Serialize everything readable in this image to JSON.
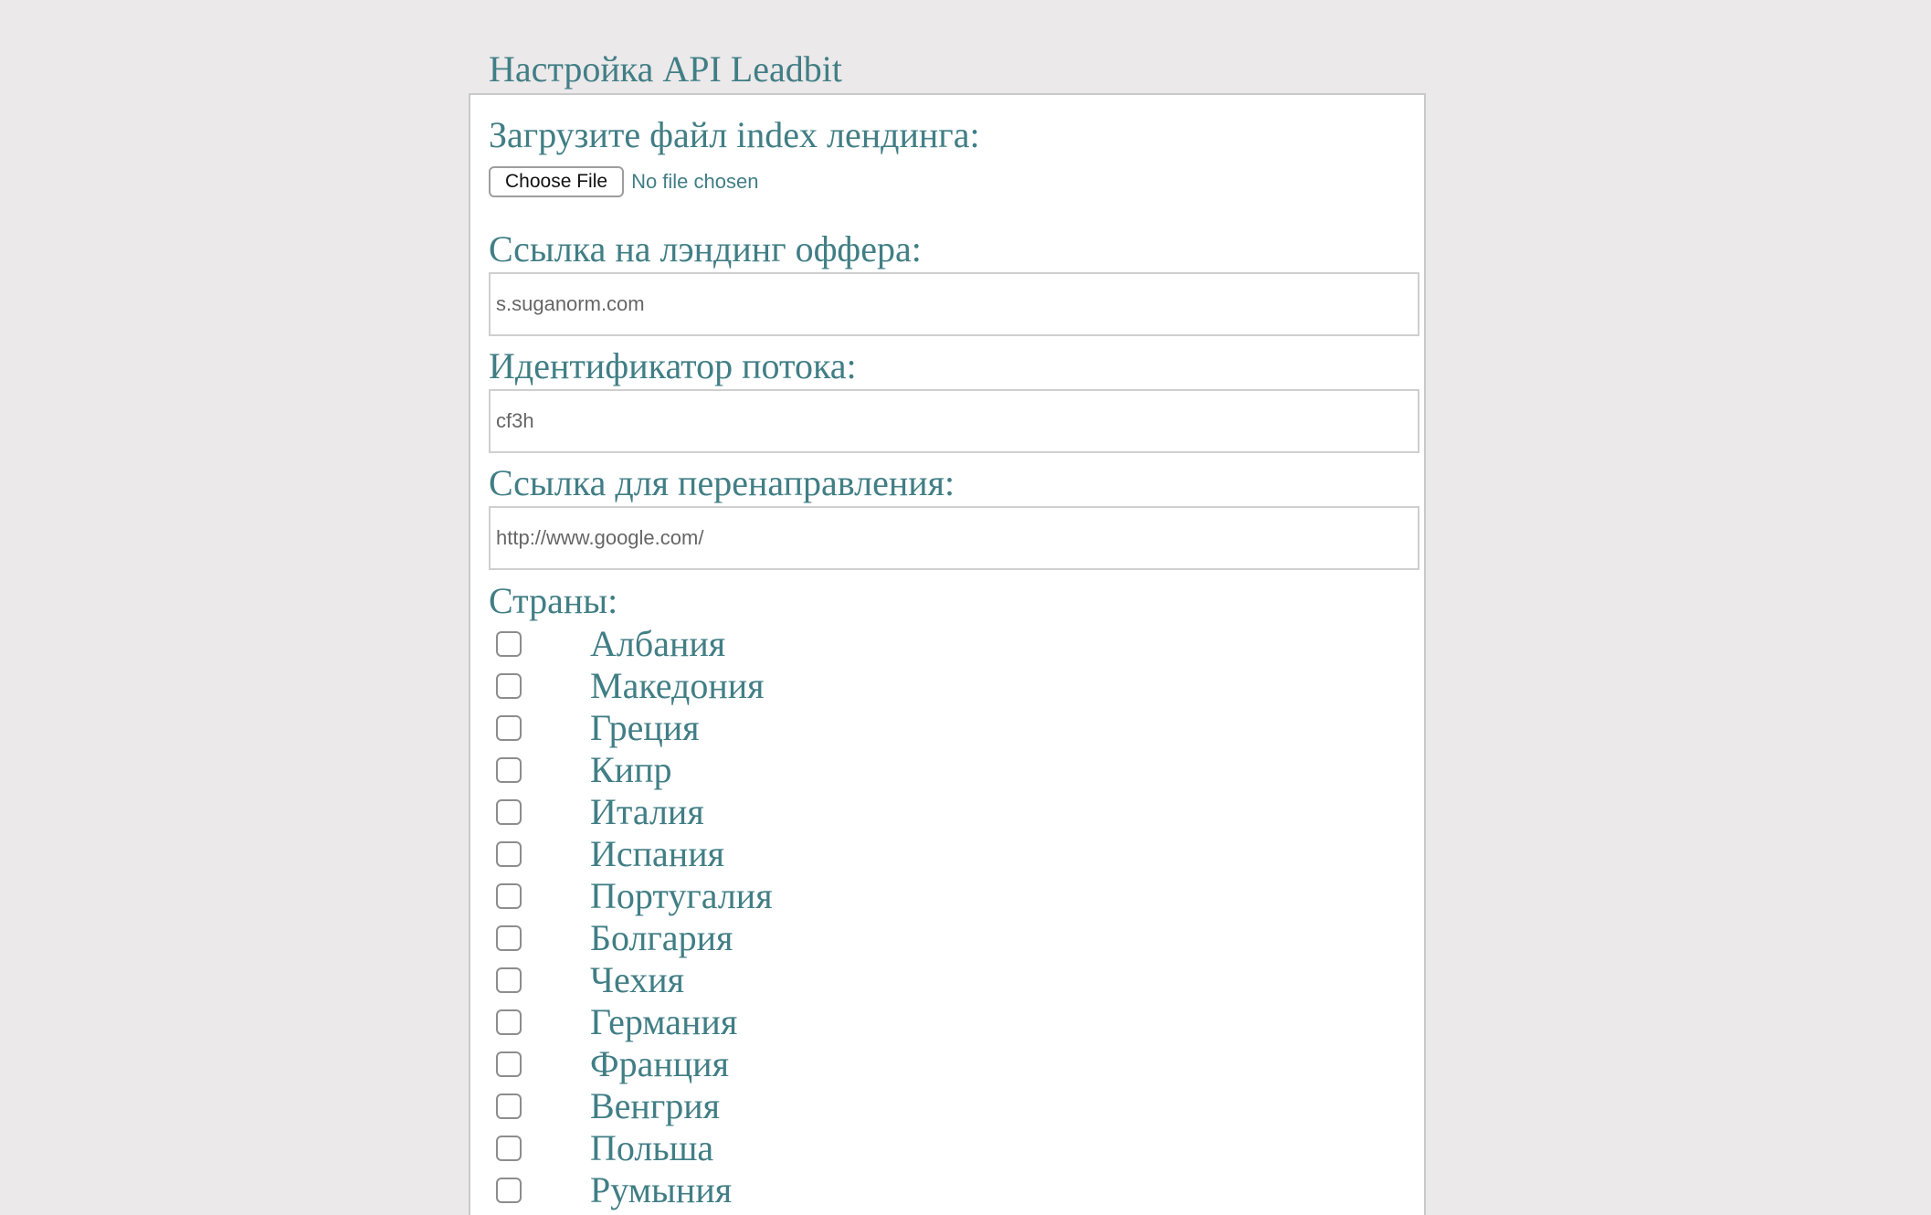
{
  "page": {
    "title": "Настройка API Leadbit"
  },
  "form": {
    "upload_label": "Загрузите файл index лендинга:",
    "upload_button": "Choose File",
    "upload_status": "No file chosen",
    "landing_label": "Ссылка на лэндинг оффера:",
    "landing_placeholder": "s.suganorm.com",
    "stream_label": "Идентификатор потока:",
    "stream_placeholder": "cf3h",
    "redirect_label": "Ссылка для перенаправления:",
    "redirect_placeholder": "http://www.google.com/",
    "countries_label": "Страны:"
  },
  "countries": [
    "Албания",
    "Македония",
    "Греция",
    "Кипр",
    "Италия",
    "Испания",
    "Португалия",
    "Болгария",
    "Чехия",
    "Германия",
    "Франция",
    "Венгрия",
    "Польша",
    "Румыния"
  ],
  "colors": {
    "background": "#ece9ea",
    "text_accent": "#417e85",
    "panel": "#ffffff"
  }
}
